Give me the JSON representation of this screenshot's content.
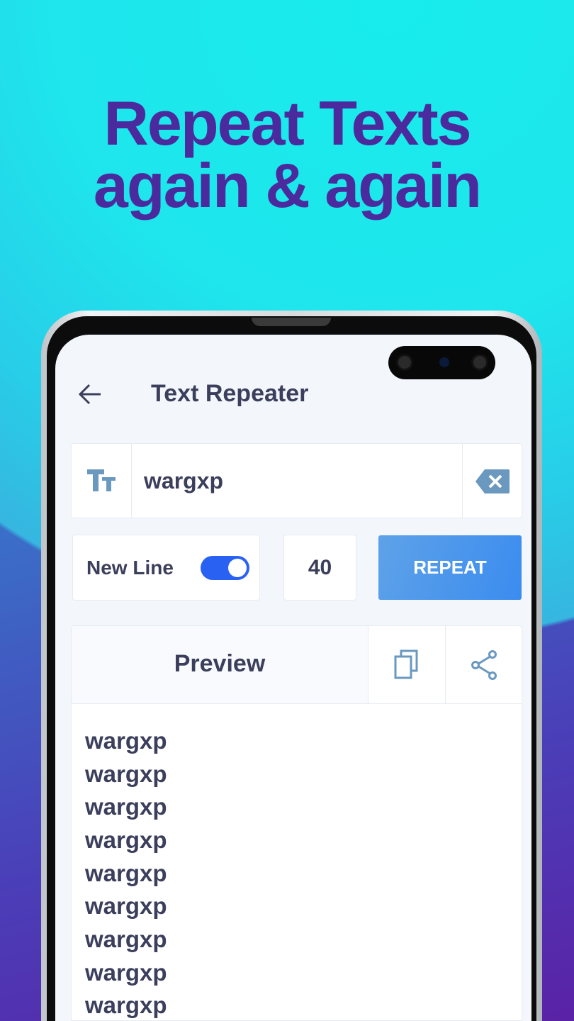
{
  "promo": {
    "line1": "Repeat Texts",
    "line2": "again & again"
  },
  "header": {
    "title": "Text Repeater",
    "back_icon": "arrow-left-icon"
  },
  "input": {
    "value": "wargxp",
    "prefix_icon": "text-size-icon",
    "clear_icon": "backspace-clear-icon"
  },
  "options": {
    "new_line_label": "New Line",
    "new_line_on": true,
    "count": "40",
    "repeat_label": "REPEAT"
  },
  "preview": {
    "title": "Preview",
    "copy_icon": "copy-icon",
    "share_icon": "share-icon",
    "lines": [
      "wargxp",
      "wargxp",
      "wargxp",
      "wargxp",
      "wargxp",
      "wargxp",
      "wargxp",
      "wargxp",
      "wargxp"
    ]
  },
  "colors": {
    "accent": "#3b8cf0",
    "toggle": "#2962f3",
    "headline": "#4b2a9e",
    "text": "#3b3f5c",
    "icon": "#6a98bf"
  }
}
